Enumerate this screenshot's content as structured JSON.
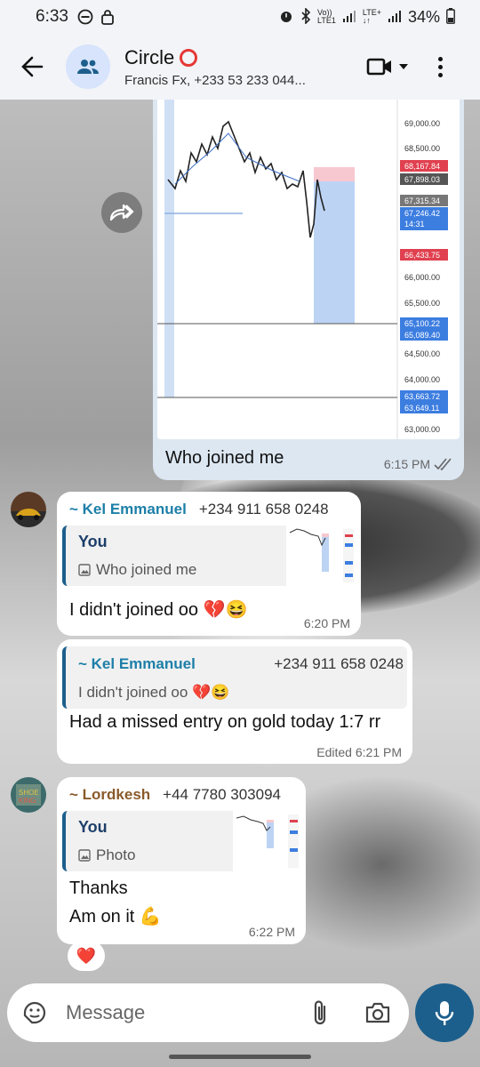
{
  "status_bar": {
    "time": "6:33",
    "network_top": "Vo))",
    "network_bottom": "LTE1",
    "lte2_top": "LTE+",
    "battery": "34%"
  },
  "header": {
    "title": "Circle",
    "subtitle": "Francis Fx, +233 53 233 044..."
  },
  "outgoing": {
    "caption": "Who joined me",
    "time": "6:15 PM",
    "chart_price_labels": [
      "69,000.00",
      "68,500.00",
      "68,167.84",
      "67,898.03",
      "67,315.34",
      "67,246.42",
      "14:31",
      "66,433.75",
      "66,000.00",
      "65,500.00",
      "65,100.22",
      "65,089.40",
      "64,500.00",
      "64,000.00",
      "63,663.72",
      "63,649.11",
      "63,000.00"
    ]
  },
  "messages": [
    {
      "sender": "~ Kel Emmanuel",
      "phone": "+234 911 658 0248",
      "reply_title": "You",
      "reply_text": "Who joined me",
      "text": "I didn't joined oo 💔😆",
      "time": "6:20 PM"
    },
    {
      "sender": "~ Kel Emmanuel",
      "phone": "+234 911 658 0248",
      "quoted_text": "I didn't joined oo 💔😆",
      "text": "Had a missed entry on gold today 1:7 rr",
      "time": "Edited 6:21 PM"
    },
    {
      "sender": "~ Lordkesh",
      "phone": "+44 7780 303094",
      "reply_title": "You",
      "reply_text": "Photo",
      "text_line1": "Thanks",
      "text_line2": "Am on it 💪",
      "time": "6:22 PM",
      "reaction": "❤️"
    }
  ],
  "input": {
    "placeholder": "Message"
  },
  "colors": {
    "accent": "#1d5f8c",
    "kel_name": "#1d7fa8",
    "lordkesh_name": "#8a5a2b",
    "out_bubble": "#dce7f2"
  }
}
